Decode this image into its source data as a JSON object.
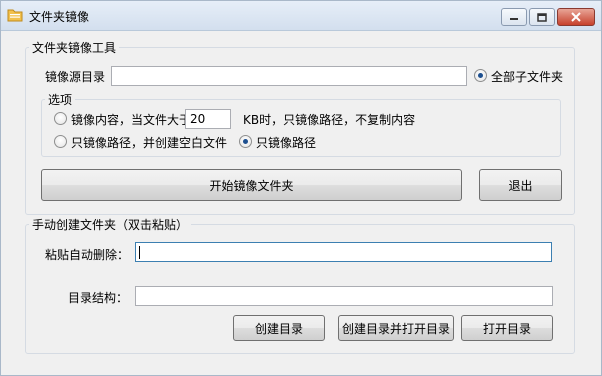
{
  "window": {
    "title": "文件夹镜像",
    "icon": "folder-icon",
    "controls": {
      "minimize": "minimize-icon",
      "maximize": "maximize-icon",
      "close": "close-icon"
    }
  },
  "mirror_group": {
    "title": "文件夹镜像工具",
    "source_label": "镜像源目录",
    "source_value": "",
    "all_subfolders_label": "全部子文件夹",
    "all_subfolders_checked": true,
    "options": {
      "title": "选项",
      "mirror_content_label": "镜像内容，当文件大于",
      "size_value": "20",
      "size_suffix": "KB时，只镜像路径，不复制内容",
      "empty_files_label": "只镜像路径，并创建空白文件",
      "path_only_label": "只镜像路径",
      "selected": "path_only"
    },
    "start_button": "开始镜像文件夹",
    "exit_button": "退出"
  },
  "manual_group": {
    "title": "手动创建文件夹（双击粘贴）",
    "paste_label": "粘贴自动删除：",
    "paste_value": "",
    "structure_label": "目录结构：",
    "structure_value": "",
    "create_button": "创建目录",
    "create_open_button": "创建目录并打开目录",
    "open_button": "打开目录"
  }
}
